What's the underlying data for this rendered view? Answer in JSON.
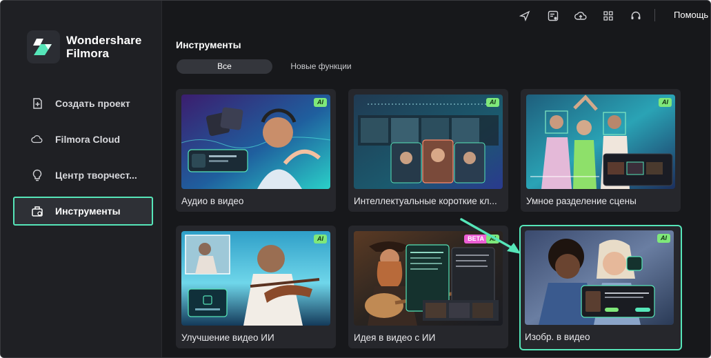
{
  "app": {
    "brand_line1": "Wondershare",
    "brand_line2": "Filmora"
  },
  "sidebar": {
    "items": [
      {
        "label": "Создать проект",
        "icon": "plus-square-icon",
        "active": false
      },
      {
        "label": "Filmora Cloud",
        "icon": "cloud-icon",
        "active": false
      },
      {
        "label": "Центр творчест...",
        "icon": "lightbulb-icon",
        "active": false
      },
      {
        "label": "Инструменты",
        "icon": "toolbox-icon",
        "active": true
      }
    ]
  },
  "topbar": {
    "icons": [
      "send-icon",
      "checklist-icon",
      "cloud-upload-icon",
      "grid-icon",
      "headset-icon"
    ],
    "help_label": "Помощь"
  },
  "main": {
    "title": "Инструменты",
    "tabs": [
      {
        "label": "Все",
        "active": true
      },
      {
        "label": "Новые функции",
        "active": false
      }
    ],
    "cards": [
      {
        "label": "Аудио в видео",
        "badge": "AI"
      },
      {
        "label": "Интеллектуальные короткие кл...",
        "badge": "AI"
      },
      {
        "label": "Умное разделение сцены",
        "badge": "AI"
      },
      {
        "label": "Улучшение видео ИИ",
        "badge": "AI"
      },
      {
        "label": "Идея в видео с ИИ",
        "badge": "AI",
        "badge2": "BETA"
      },
      {
        "label": "Изобр. в видео",
        "badge": "AI",
        "highlighted": true
      }
    ]
  },
  "colors": {
    "accent": "#56e6b9",
    "ai_badge": "#7fe87a",
    "beta_badge": "#ec5ed3",
    "background": "#17181b",
    "sidebar": "#1f2024",
    "card": "#26272c"
  }
}
